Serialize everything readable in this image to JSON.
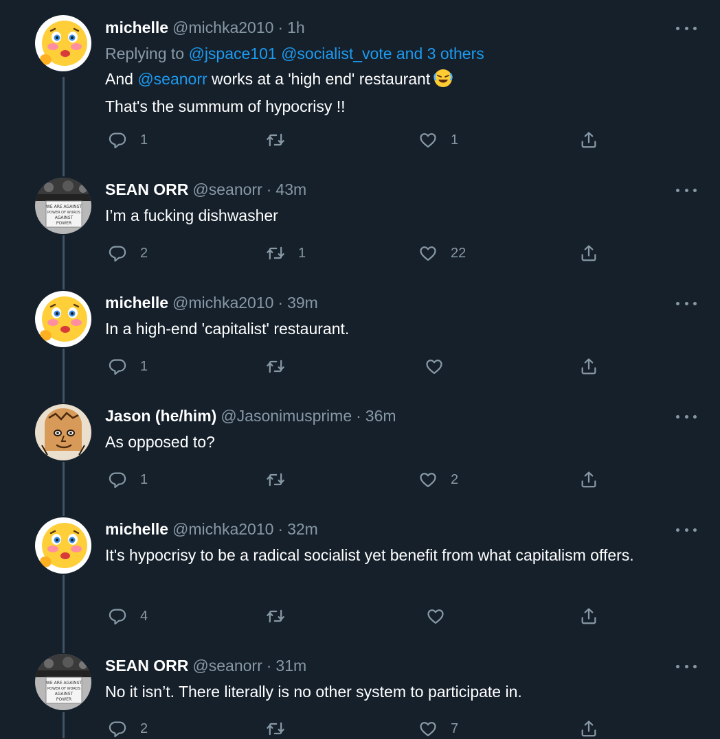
{
  "tweets": [
    {
      "name": "michelle",
      "handle": "@michka2010",
      "separator": "·",
      "time": "1h",
      "avatar_icon": "blushing-emoji-avatar",
      "replying_prefix": "Replying to",
      "replying_links": "@jspace101 @socialist_vote and 3 others",
      "text_parts": {
        "pre": "And ",
        "mention": "@seanorr",
        "post": " works at a 'high end' restaurant",
        "emoji": "rolling-on-floor-laughing-icon",
        "line2": "That's the summum of hypocrisy !!"
      },
      "reply_count": "1",
      "retweet_count": "",
      "like_count": "1"
    },
    {
      "name": "SEAN ORR",
      "handle": "@seanorr",
      "separator": "·",
      "time": "43m",
      "avatar_icon": "protest-photo-avatar",
      "avatar_text": [
        "WE ARE AGAINST",
        "POWER OF WORDS",
        "AGAINST",
        "POWER"
      ],
      "text": "I’m a fucking dishwasher",
      "reply_count": "2",
      "retweet_count": "1",
      "like_count": "22"
    },
    {
      "name": "michelle",
      "handle": "@michka2010",
      "separator": "·",
      "time": "39m",
      "avatar_icon": "blushing-emoji-avatar",
      "text": "In a high-end 'capitalist' restaurant.",
      "reply_count": "1",
      "retweet_count": "",
      "like_count": ""
    },
    {
      "name": "Jason (he/him)",
      "handle": "@Jasonimusprime",
      "separator": "·",
      "time": "36m",
      "avatar_icon": "toast-face-avatar",
      "text": "As opposed to?",
      "reply_count": "1",
      "retweet_count": "",
      "like_count": "2"
    },
    {
      "name": "michelle",
      "handle": "@michka2010",
      "separator": "·",
      "time": "32m",
      "avatar_icon": "blushing-emoji-avatar",
      "text": "It's hypocrisy to be a radical socialist yet benefit from what capitalism offers.",
      "reply_count": "4",
      "retweet_count": "",
      "like_count": ""
    },
    {
      "name": "SEAN ORR",
      "handle": "@seanorr",
      "separator": "·",
      "time": "31m",
      "avatar_icon": "protest-photo-avatar",
      "avatar_text": [
        "WE ARE AGAINST",
        "POWER OF WORDS",
        "AGAINST",
        "POWER"
      ],
      "text": "No it isn’t. There literally is no other system to participate in.",
      "reply_count": "2",
      "retweet_count": "",
      "like_count": "7"
    }
  ],
  "colors": {
    "background": "#15202b",
    "secondary_text": "#8899a6",
    "link": "#1d9bf0",
    "thread_line": "#3d5466"
  }
}
